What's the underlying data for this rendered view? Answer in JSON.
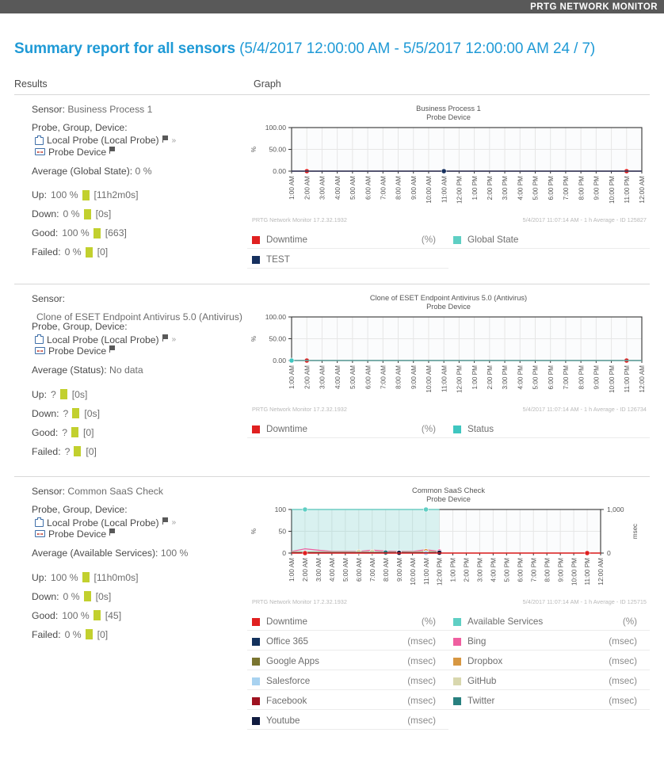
{
  "header": {
    "brand": "PRTG NETWORK MONITOR"
  },
  "report": {
    "title": "Summary report for all sensors",
    "range": "(5/4/2017 12:00:00 AM - 5/5/2017 12:00:00 AM 24 / 7)",
    "col_results": "Results",
    "col_graph": "Graph"
  },
  "labels": {
    "sensor": "Sensor:",
    "pgd": "Probe, Group, Device:",
    "up": "Up:",
    "down": "Down:",
    "good": "Good:",
    "failed": "Failed:",
    "chevron": "»",
    "probe_node": "Local Probe (Local Probe)",
    "device_node": "Probe Device",
    "footer_left": "PRTG Network Monitor 17.2.32.1932"
  },
  "sensors": [
    {
      "name": "Business Process 1",
      "average_label": "Average (Global State):",
      "average_value": "0 %",
      "up": {
        "pct": "100 %",
        "detail": "[11h2m0s]"
      },
      "down": {
        "pct": "0 %",
        "detail": "[0s]"
      },
      "good": {
        "pct": "100 %",
        "detail": "[663]"
      },
      "failed": {
        "pct": "0 %",
        "detail": "[0]"
      },
      "graph": {
        "title": "Business Process 1",
        "subtitle": "Probe Device",
        "footer_right": "5/4/2017 11:07:14 AM - 1 h Average - ID 125827"
      },
      "legend": [
        {
          "name": "Downtime",
          "unit": "(%)",
          "color": "#e02020"
        },
        {
          "name": "Global State",
          "unit": "",
          "color": "#5fcfc4"
        },
        {
          "name": "TEST",
          "unit": "",
          "color": "#16305e"
        }
      ]
    },
    {
      "name": "Clone of ESET Endpoint Antivirus 5.0 (Antivirus)",
      "average_label": "Average (Status):",
      "average_value": "No data",
      "up": {
        "pct": "?",
        "detail": "[0s]"
      },
      "down": {
        "pct": "?",
        "detail": "[0s]"
      },
      "good": {
        "pct": "?",
        "detail": "[0]"
      },
      "failed": {
        "pct": "?",
        "detail": "[0]"
      },
      "graph": {
        "title": "Clone of ESET Endpoint Antivirus 5.0 (Antivirus)",
        "subtitle": "Probe Device",
        "footer_right": "5/4/2017 11:07:14 AM - 1 h Average - ID 126734"
      },
      "legend": [
        {
          "name": "Downtime",
          "unit": "(%)",
          "color": "#e02020"
        },
        {
          "name": "Status",
          "unit": "",
          "color": "#3fc6c0"
        }
      ]
    },
    {
      "name": "Common SaaS Check",
      "average_label": "Average (Available Services):",
      "average_value": "100 %",
      "up": {
        "pct": "100 %",
        "detail": "[11h0m0s]"
      },
      "down": {
        "pct": "0 %",
        "detail": "[0s]"
      },
      "good": {
        "pct": "100 %",
        "detail": "[45]"
      },
      "failed": {
        "pct": "0 %",
        "detail": "[0]"
      },
      "graph": {
        "title": "Common SaaS Check",
        "subtitle": "Probe Device",
        "footer_right": "5/4/2017 11:07:14 AM - 1 h Average - ID 125715"
      },
      "legend": [
        {
          "name": "Downtime",
          "unit": "(%)",
          "color": "#e02020"
        },
        {
          "name": "Available Services",
          "unit": "(%)",
          "color": "#5fcfc4"
        },
        {
          "name": "Office 365",
          "unit": "(msec)",
          "color": "#13315c"
        },
        {
          "name": "Bing",
          "unit": "(msec)",
          "color": "#ef5fa0"
        },
        {
          "name": "Google Apps",
          "unit": "(msec)",
          "color": "#7a7530"
        },
        {
          "name": "Dropbox",
          "unit": "(msec)",
          "color": "#d79742"
        },
        {
          "name": "Salesforce",
          "unit": "(msec)",
          "color": "#a8d2f0"
        },
        {
          "name": "GitHub",
          "unit": "(msec)",
          "color": "#d8d7ae"
        },
        {
          "name": "Facebook",
          "unit": "(msec)",
          "color": "#9e1220"
        },
        {
          "name": "Twitter",
          "unit": "(msec)",
          "color": "#28807f"
        },
        {
          "name": "Youtube",
          "unit": "(msec)",
          "color": "#101b3f"
        }
      ]
    }
  ],
  "chart_data": [
    {
      "type": "line",
      "title": "Business Process 1",
      "subtitle": "Probe Device",
      "xlabel": "",
      "ylabel": "%",
      "ylim": [
        0,
        100
      ],
      "yticks": [
        "0.00",
        "50.00",
        "100.00"
      ],
      "grid": true,
      "x": [
        "1:00 AM",
        "2:00 AM",
        "3:00 AM",
        "4:00 AM",
        "5:00 AM",
        "6:00 AM",
        "7:00 AM",
        "8:00 AM",
        "9:00 AM",
        "10:00 AM",
        "11:00 AM",
        "12:00 PM",
        "1:00 PM",
        "2:00 PM",
        "3:00 PM",
        "4:00 PM",
        "5:00 PM",
        "6:00 PM",
        "7:00 PM",
        "8:00 PM",
        "9:00 PM",
        "10:00 PM",
        "11:00 PM",
        "12:00 AM"
      ],
      "series": [
        {
          "name": "Downtime",
          "color": "#e02020",
          "unit": "(%)",
          "values": [
            0,
            0,
            0,
            0,
            0,
            0,
            0,
            0,
            0,
            0,
            0,
            0,
            0,
            0,
            0,
            0,
            0,
            0,
            0,
            0,
            0,
            0,
            0,
            0
          ],
          "markers_at": [
            "2:00 AM",
            "11:00 PM"
          ]
        },
        {
          "name": "Global State",
          "color": "#5fcfc4",
          "unit": "",
          "values": [
            0,
            0,
            0,
            0,
            0,
            0,
            0,
            0,
            0,
            0,
            0,
            0,
            0,
            0,
            0,
            0,
            0,
            0,
            0,
            0,
            0,
            0,
            0,
            0
          ],
          "markers_at": []
        },
        {
          "name": "TEST",
          "color": "#16305e",
          "unit": "",
          "values": [
            0,
            0,
            0,
            0,
            0,
            0,
            0,
            0,
            0,
            0,
            0,
            0,
            0,
            0,
            0,
            0,
            0,
            0,
            0,
            0,
            0,
            0,
            0,
            0
          ],
          "markers_at": [
            "11:00 AM"
          ]
        }
      ]
    },
    {
      "type": "line",
      "title": "Clone of ESET Endpoint Antivirus 5.0 (Antivirus)",
      "subtitle": "Probe Device",
      "xlabel": "",
      "ylabel": "%",
      "ylim": [
        0,
        100
      ],
      "yticks": [
        "0.00",
        "50.00",
        "100.00"
      ],
      "grid": true,
      "x": [
        "1:00 AM",
        "2:00 AM",
        "3:00 AM",
        "4:00 AM",
        "5:00 AM",
        "6:00 AM",
        "7:00 AM",
        "8:00 AM",
        "9:00 AM",
        "10:00 AM",
        "11:00 AM",
        "12:00 PM",
        "1:00 PM",
        "2:00 PM",
        "3:00 PM",
        "4:00 PM",
        "5:00 PM",
        "6:00 PM",
        "7:00 PM",
        "8:00 PM",
        "9:00 PM",
        "10:00 PM",
        "11:00 PM",
        "12:00 AM"
      ],
      "series": [
        {
          "name": "Downtime",
          "color": "#e02020",
          "unit": "(%)",
          "values": [
            0,
            0,
            0,
            0,
            0,
            0,
            0,
            0,
            0,
            0,
            0,
            0,
            0,
            0,
            0,
            0,
            0,
            0,
            0,
            0,
            0,
            0,
            0,
            0
          ],
          "markers_at": [
            "2:00 AM",
            "11:00 PM"
          ]
        },
        {
          "name": "Status",
          "color": "#3fc6c0",
          "unit": "",
          "values": [
            0,
            0,
            0,
            0,
            0,
            0,
            0,
            0,
            0,
            0,
            0,
            0,
            0,
            0,
            0,
            0,
            0,
            0,
            0,
            0,
            0,
            0,
            0,
            0
          ],
          "markers_at": [
            "1:00 AM"
          ]
        }
      ]
    },
    {
      "type": "line",
      "title": "Common SaaS Check",
      "subtitle": "Probe Device",
      "xlabel": "",
      "ylabel": "%",
      "y2label": "msec",
      "ylim": [
        0,
        100
      ],
      "yticks": [
        "0",
        "50",
        "100"
      ],
      "y2lim": [
        0,
        1000
      ],
      "y2ticks": [
        "0",
        "1,000"
      ],
      "grid": true,
      "x": [
        "1:00 AM",
        "2:00 AM",
        "3:00 AM",
        "4:00 AM",
        "5:00 AM",
        "6:00 AM",
        "7:00 AM",
        "8:00 AM",
        "9:00 AM",
        "10:00 AM",
        "11:00 AM",
        "12:00 PM",
        "1:00 PM",
        "2:00 PM",
        "3:00 PM",
        "4:00 PM",
        "5:00 PM",
        "6:00 PM",
        "7:00 PM",
        "8:00 PM",
        "9:00 PM",
        "10:00 PM",
        "11:00 PM",
        "12:00 AM"
      ],
      "series": [
        {
          "name": "Available Services",
          "color": "#5fcfc4",
          "unit": "(%)",
          "axis": "left",
          "filled": true,
          "values": [
            100,
            100,
            100,
            100,
            100,
            100,
            100,
            100,
            100,
            100,
            100,
            100,
            null,
            null,
            null,
            null,
            null,
            null,
            null,
            null,
            null,
            null,
            null,
            null
          ],
          "markers_at": [
            "2:00 AM",
            "11:00 AM"
          ]
        },
        {
          "name": "Bing",
          "color": "#ef5fa0",
          "unit": "(msec)",
          "axis": "right",
          "values": [
            37,
            97,
            66,
            38,
            38,
            38,
            68,
            45,
            38,
            38,
            78,
            38,
            null,
            null,
            null,
            null,
            null,
            null,
            null,
            null,
            null,
            null,
            null,
            null
          ],
          "markers_at": [
            "12:00 PM"
          ]
        },
        {
          "name": "Dropbox",
          "color": "#d79742",
          "unit": "(msec)",
          "axis": "right",
          "values": [
            25,
            22,
            19,
            19,
            19,
            19,
            19,
            19,
            19,
            19,
            44,
            24,
            null,
            null,
            null,
            null,
            null,
            null,
            null,
            null,
            null,
            null,
            null,
            null
          ],
          "markers_at": [
            "11:00 AM"
          ]
        },
        {
          "name": "GitHub",
          "color": "#d8d7ae",
          "unit": "(msec)",
          "axis": "right",
          "values": [
            30,
            30,
            30,
            30,
            30,
            30,
            30,
            30,
            30,
            30,
            30,
            30,
            null,
            null,
            null,
            null,
            null,
            null,
            null,
            null,
            null,
            null,
            null,
            null
          ],
          "markers_at": [
            "6:00 AM",
            "7:00 AM"
          ]
        },
        {
          "name": "Google Apps",
          "color": "#7a7530",
          "unit": "(msec)",
          "axis": "right",
          "values": [
            12,
            11,
            11,
            11,
            11,
            11,
            11,
            11,
            11,
            11,
            12,
            11,
            null,
            null,
            null,
            null,
            null,
            null,
            null,
            null,
            null,
            null,
            null,
            null
          ],
          "markers_at": [
            "8:00 AM"
          ]
        },
        {
          "name": "Twitter",
          "color": "#28807f",
          "unit": "(msec)",
          "axis": "right",
          "values": [
            10,
            10,
            10,
            10,
            10,
            10,
            10,
            13,
            11,
            10,
            10,
            13,
            null,
            null,
            null,
            null,
            null,
            null,
            null,
            null,
            null,
            null,
            null,
            null
          ],
          "markers_at": [
            "8:00 AM"
          ]
        },
        {
          "name": "Office 365",
          "color": "#13315c",
          "unit": "(msec)",
          "axis": "right",
          "values": [
            9,
            9,
            9,
            9,
            9,
            9,
            9,
            9,
            12,
            9,
            9,
            9,
            null,
            null,
            null,
            null,
            null,
            null,
            null,
            null,
            null,
            null,
            null,
            null
          ],
          "markers_at": [
            "9:00 AM",
            "12:00 PM"
          ]
        },
        {
          "name": "Facebook",
          "color": "#9e1220",
          "unit": "(msec)",
          "axis": "right",
          "values": [
            8,
            8,
            8,
            8,
            8,
            8,
            8,
            8,
            11,
            8,
            8,
            8,
            null,
            null,
            null,
            null,
            null,
            null,
            null,
            null,
            null,
            null,
            null,
            null
          ],
          "markers_at": [
            "9:00 AM"
          ]
        },
        {
          "name": "Salesforce",
          "color": "#a8d2f0",
          "unit": "(msec)",
          "axis": "right",
          "values": [
            6,
            6,
            6,
            6,
            6,
            6,
            6,
            6,
            5,
            6,
            4,
            6,
            null,
            null,
            null,
            null,
            null,
            null,
            null,
            null,
            null,
            null,
            null,
            null
          ],
          "markers_at": [
            "11:00 AM"
          ]
        },
        {
          "name": "Youtube",
          "color": "#101b3f",
          "unit": "(msec)",
          "axis": "right",
          "values": [
            7,
            7,
            7,
            7,
            7,
            7,
            7,
            7,
            6,
            7,
            7,
            9,
            null,
            null,
            null,
            null,
            null,
            null,
            null,
            null,
            null,
            null,
            null,
            null
          ],
          "markers_at": [
            "9:00 AM",
            "12:00 PM"
          ]
        },
        {
          "name": "Downtime",
          "color": "#e02020",
          "unit": "(%)",
          "axis": "left",
          "values": [
            0,
            0,
            0,
            0,
            0,
            0,
            0,
            0,
            0,
            0,
            0,
            0,
            0,
            0,
            0,
            0,
            0,
            0,
            0,
            0,
            0,
            0,
            0,
            0
          ],
          "markers_at": [
            "2:00 AM",
            "11:00 PM"
          ]
        }
      ]
    }
  ]
}
